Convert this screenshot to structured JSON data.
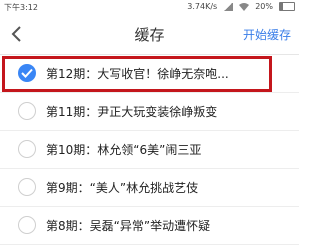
{
  "status_bar": {
    "time": "下午3:12",
    "speed": "3.74K/s",
    "battery": "20%"
  },
  "header": {
    "title": "缓存",
    "action": "开始缓存"
  },
  "episodes": [
    {
      "title": "第12期：大写收官！徐峥无奈咆...",
      "checked": true
    },
    {
      "title": "第11期：尹正大玩变装徐峥叛变",
      "checked": false
    },
    {
      "title": "第10期：林允领“6美”闹三亚",
      "checked": false
    },
    {
      "title": "第9期：“美人”林允挑战艺伎",
      "checked": false
    },
    {
      "title": "第8期：吴磊“异常”举动遭怀疑",
      "checked": false
    }
  ]
}
